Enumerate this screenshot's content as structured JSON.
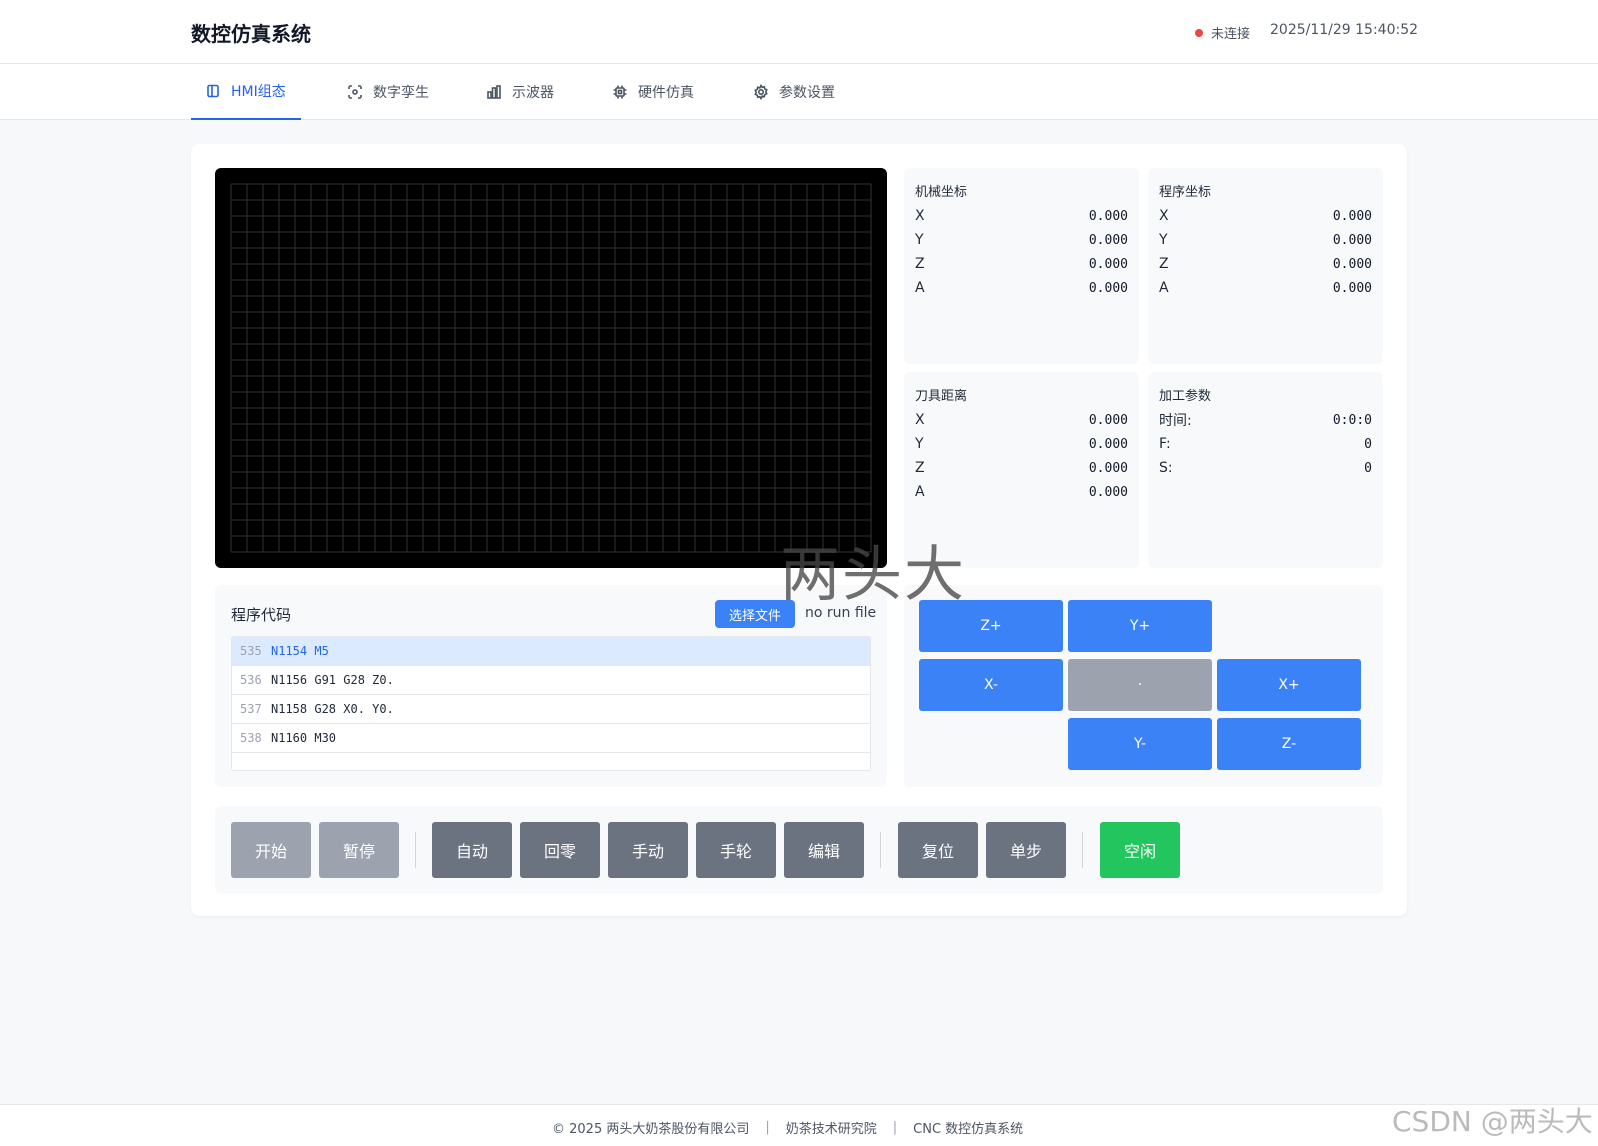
{
  "header": {
    "title": "数控仿真系统",
    "connection_status": "未连接",
    "datetime": "2025/11/29 15:40:52",
    "status_color": "#ef4444"
  },
  "tabs": [
    {
      "label": "HMI组态",
      "icon": "panel-icon",
      "active": true
    },
    {
      "label": "数字孪生",
      "icon": "twin-icon",
      "active": false
    },
    {
      "label": "示波器",
      "icon": "bar-chart-icon",
      "active": false
    },
    {
      "label": "硬件仿真",
      "icon": "chip-icon",
      "active": false
    },
    {
      "label": "参数设置",
      "icon": "gear-icon",
      "active": false
    }
  ],
  "panels": {
    "machine": {
      "title": "机械坐标",
      "rows": [
        {
          "label": "X",
          "value": "0.000"
        },
        {
          "label": "Y",
          "value": "0.000"
        },
        {
          "label": "Z",
          "value": "0.000"
        },
        {
          "label": "A",
          "value": "0.000"
        }
      ]
    },
    "program": {
      "title": "程序坐标",
      "rows": [
        {
          "label": "X",
          "value": "0.000"
        },
        {
          "label": "Y",
          "value": "0.000"
        },
        {
          "label": "Z",
          "value": "0.000"
        },
        {
          "label": "A",
          "value": "0.000"
        }
      ]
    },
    "tool": {
      "title": "刀具距离",
      "rows": [
        {
          "label": "X",
          "value": "0.000"
        },
        {
          "label": "Y",
          "value": "0.000"
        },
        {
          "label": "Z",
          "value": "0.000"
        },
        {
          "label": "A",
          "value": "0.000"
        }
      ]
    },
    "process": {
      "title": "加工参数",
      "rows": [
        {
          "label": "时间:",
          "value": "0:0:0"
        },
        {
          "label": "F:",
          "value": "0"
        },
        {
          "label": "S:",
          "value": "0"
        }
      ]
    }
  },
  "program_code": {
    "title": "程序代码",
    "select_file_label": "选择文件",
    "file_status": "no run file",
    "lines": [
      {
        "num": "535",
        "code": "N1154 M5",
        "current": true
      },
      {
        "num": "536",
        "code": "N1156 G91 G28 Z0.",
        "current": false
      },
      {
        "num": "537",
        "code": "N1158 G28 X0. Y0.",
        "current": false
      },
      {
        "num": "538",
        "code": "N1160 M30",
        "current": false
      }
    ]
  },
  "jog": {
    "z_plus": "Z+",
    "y_plus": "Y+",
    "x_minus": "X-",
    "center": "·",
    "x_plus": "X+",
    "y_minus": "Y-",
    "z_minus": "Z-"
  },
  "controls": {
    "start": "开始",
    "pause": "暂停",
    "auto": "自动",
    "home": "回零",
    "manual": "手动",
    "handwheel": "手轮",
    "edit": "编辑",
    "reset": "复位",
    "single_step": "单步",
    "idle": "空闲"
  },
  "watermark": "两头大",
  "footer": {
    "copyright": "© 2025 两头大奶茶股份有限公司",
    "institute": "奶茶技术研究院",
    "system": "CNC 数控仿真系统",
    "separator": "|"
  },
  "csdn_watermark": "CSDN @两头大"
}
